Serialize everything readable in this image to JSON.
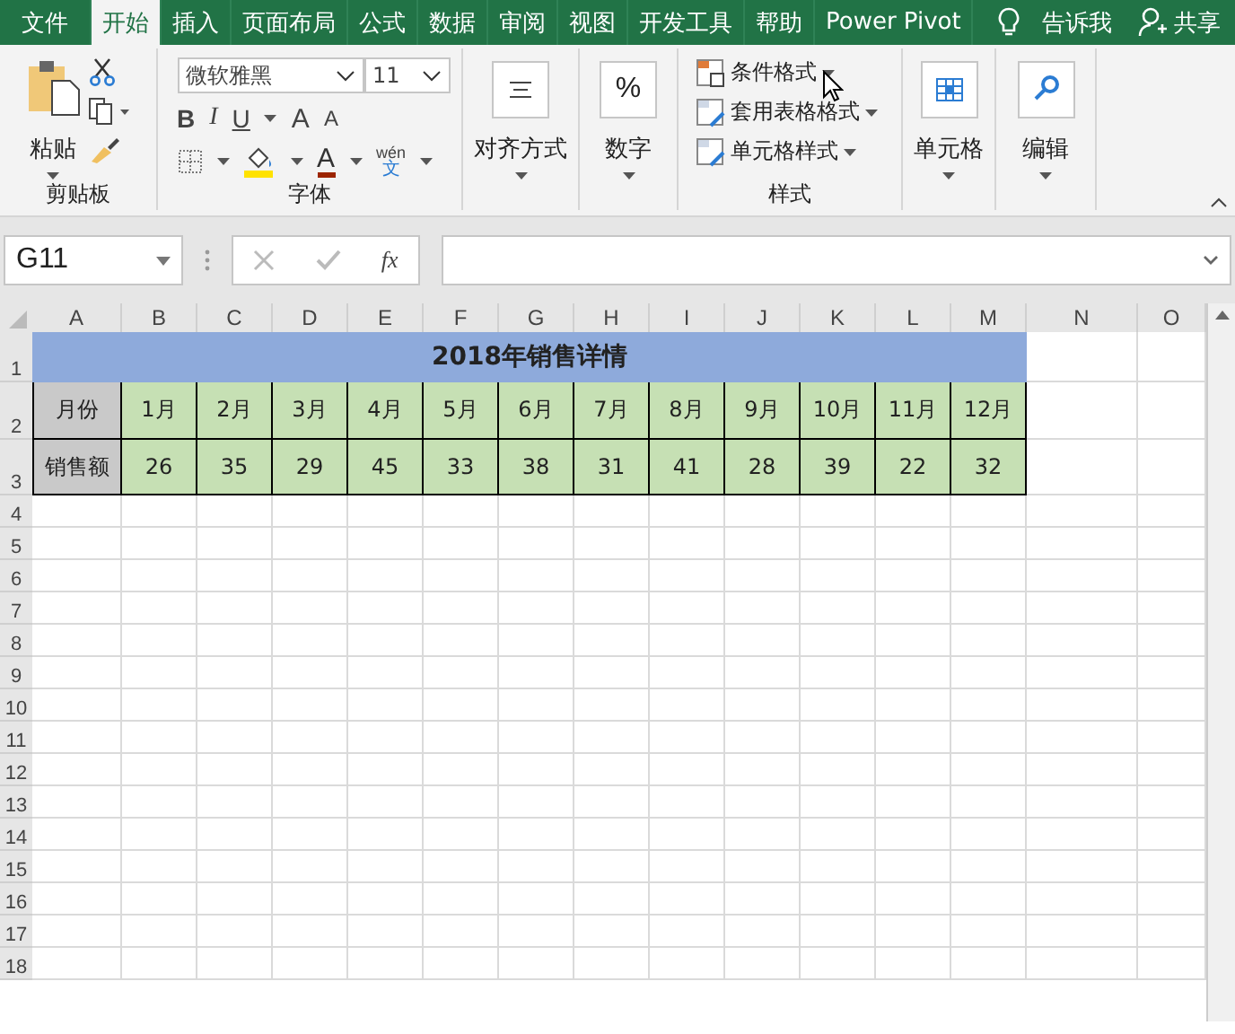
{
  "tabs": [
    {
      "label": "文件",
      "selected": false
    },
    {
      "label": "开始",
      "selected": true
    },
    {
      "label": "插入",
      "selected": false
    },
    {
      "label": "页面布局",
      "selected": false
    },
    {
      "label": "公式",
      "selected": false
    },
    {
      "label": "数据",
      "selected": false
    },
    {
      "label": "审阅",
      "selected": false
    },
    {
      "label": "视图",
      "selected": false
    },
    {
      "label": "开发工具",
      "selected": false
    },
    {
      "label": "帮助",
      "selected": false
    },
    {
      "label": "Power Pivot",
      "selected": false
    }
  ],
  "tell_me": "告诉我",
  "share": "共享",
  "ribbon": {
    "paste": "粘贴",
    "clipboard_group": "剪贴板",
    "font_name": "微软雅黑",
    "font_size": "11",
    "bold": "B",
    "italic": "I",
    "underline": "U",
    "grow": "A",
    "shrink": "A",
    "font_color": "A",
    "phonetic_top": "wén",
    "phonetic_bottom": "文",
    "font_group": "字体",
    "alignment": "对齐方式",
    "number": "数字",
    "number_symbol": "%",
    "styles": [
      "条件格式",
      "套用表格格式",
      "单元格样式"
    ],
    "styles_group": "样式",
    "cells": "单元格",
    "editing": "编辑"
  },
  "formula_bar": {
    "name_box": "G11",
    "fx": "fx"
  },
  "sheet": {
    "columns": [
      "A",
      "B",
      "C",
      "D",
      "E",
      "F",
      "G",
      "H",
      "I",
      "J",
      "K",
      "L",
      "M",
      "N",
      "O"
    ],
    "rows": [
      "1",
      "2",
      "3",
      "4",
      "5",
      "6",
      "7",
      "8",
      "9",
      "10",
      "11",
      "12",
      "13",
      "14",
      "15",
      "16",
      "17",
      "18"
    ],
    "title": "2018年销售详情",
    "month_label": "月份",
    "months": [
      "1月",
      "2月",
      "3月",
      "4月",
      "5月",
      "6月",
      "7月",
      "8月",
      "9月",
      "10月",
      "11月",
      "12月"
    ],
    "sales_label": "销售额",
    "sales": [
      "26",
      "35",
      "29",
      "45",
      "33",
      "38",
      "31",
      "41",
      "28",
      "39",
      "22",
      "32"
    ]
  }
}
